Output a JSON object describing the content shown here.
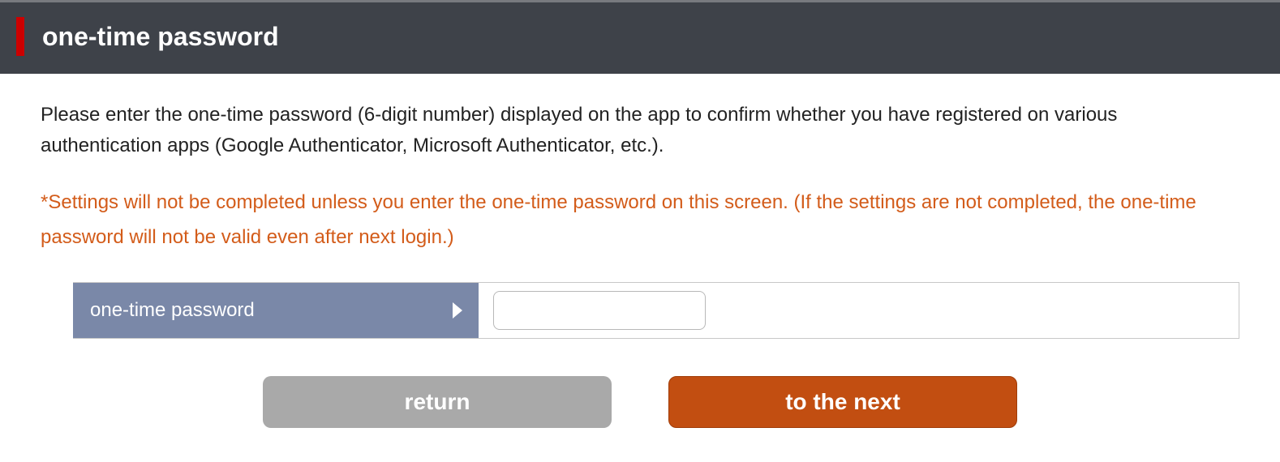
{
  "header": {
    "title": "one-time password"
  },
  "content": {
    "instruction": "Please enter the one-time password (6-digit number) displayed on the app to confirm whether you have registered on various authentication apps (Google Authenticator, Microsoft Authenticator, etc.).",
    "warning": "*Settings will not be completed unless you enter the one-time password on this screen. (If the settings are not completed, the one-time password will not be valid even after next login.)"
  },
  "form": {
    "field_label": "one-time password",
    "input_value": ""
  },
  "buttons": {
    "return_label": "return",
    "next_label": "to the next"
  }
}
